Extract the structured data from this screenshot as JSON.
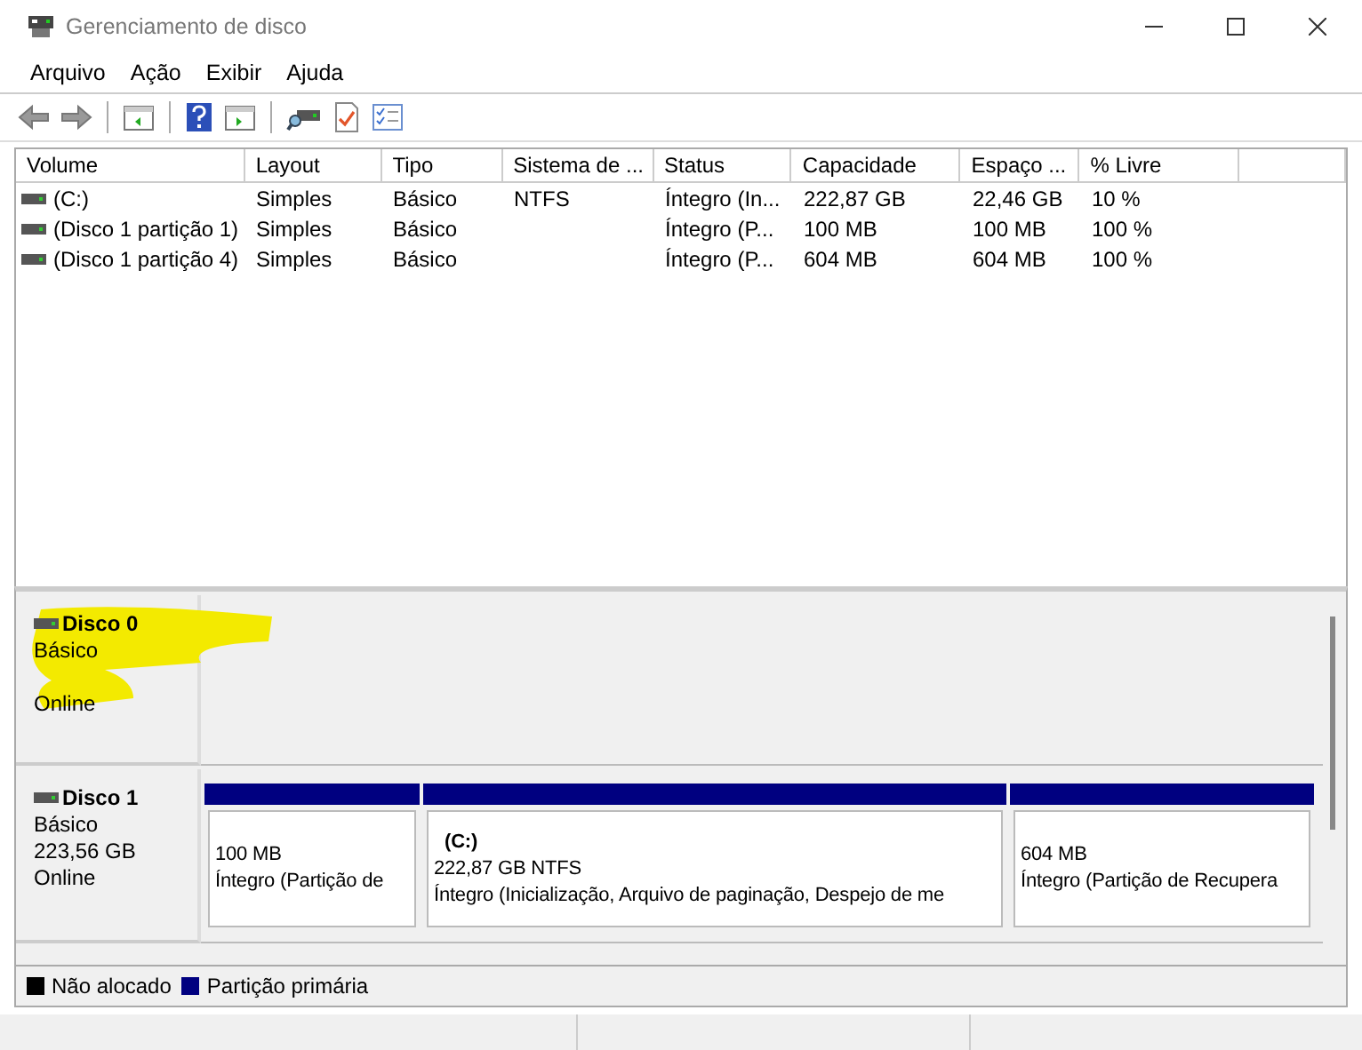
{
  "window": {
    "title": "Gerenciamento de disco"
  },
  "menu": [
    "Arquivo",
    "Ação",
    "Exibir",
    "Ajuda"
  ],
  "table": {
    "columns": [
      "Volume",
      "Layout",
      "Tipo",
      "Sistema de ...",
      "Status",
      "Capacidade",
      "Espaço ...",
      "% Livre"
    ],
    "rows": [
      {
        "cells": [
          "(C:)",
          "Simples",
          "Básico",
          "NTFS",
          "Íntegro (In...",
          "222,87 GB",
          "22,46 GB",
          "10 %"
        ]
      },
      {
        "cells": [
          "(Disco 1 partição 1)",
          "Simples",
          "Básico",
          "",
          "Íntegro (P...",
          "100 MB",
          "100 MB",
          "100 %"
        ]
      },
      {
        "cells": [
          "(Disco 1 partição 4)",
          "Simples",
          "Básico",
          "",
          "Íntegro (P...",
          "604 MB",
          "604 MB",
          "100 %"
        ]
      }
    ]
  },
  "disks": [
    {
      "name": "Disco 0",
      "type": "Básico",
      "status": "Online",
      "highlighted": true
    },
    {
      "name": "Disco 1",
      "type": "Básico",
      "size": "223,56 GB",
      "status": "Online",
      "highlighted": false,
      "partitions": [
        {
          "size": "100 MB",
          "status": "Íntegro (Partição de"
        },
        {
          "label": "(C:)",
          "size": "222,87 GB NTFS",
          "status": "Íntegro (Inicialização, Arquivo de paginação, Despejo de me"
        },
        {
          "size": "604 MB",
          "status": "Íntegro (Partição de Recupera"
        }
      ]
    }
  ],
  "legend": [
    {
      "label": "Não alocado",
      "color": "#000000"
    },
    {
      "label": "Partição primária",
      "color": "#000080"
    }
  ]
}
